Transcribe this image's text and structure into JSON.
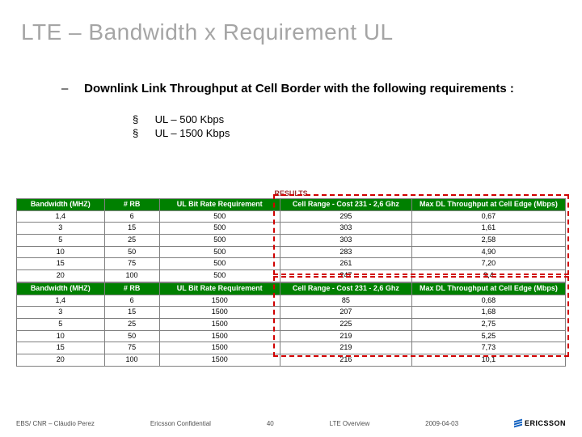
{
  "title": "LTE – Bandwidth x Requirement UL",
  "intro_prefix": "–",
  "intro": "Downlink Link Throughput at Cell Border with the following requirements :",
  "sublist": {
    "bullet": "§",
    "items": [
      "UL – 500 Kbps",
      "UL – 1500 Kbps"
    ]
  },
  "results_label": "RESULTS",
  "chart_data": [
    {
      "type": "table",
      "columns": [
        "Bandwidth (MHZ)",
        "# RB",
        "UL Bit Rate Requirement",
        "Cell Range - Cost 231 - 2,6 Ghz",
        "Max DL Throughput at Cell Edge (Mbps)"
      ],
      "rows": [
        [
          "1,4",
          "6",
          "500",
          "295",
          "0,67"
        ],
        [
          "3",
          "15",
          "500",
          "303",
          "1,61"
        ],
        [
          "5",
          "25",
          "500",
          "303",
          "2,58"
        ],
        [
          "10",
          "50",
          "500",
          "283",
          "4,90"
        ],
        [
          "15",
          "75",
          "500",
          "261",
          "7,20"
        ],
        [
          "20",
          "100",
          "500",
          "247",
          "9,4"
        ]
      ]
    },
    {
      "type": "table",
      "columns": [
        "Bandwidth (MHZ)",
        "# RB",
        "UL Bit Rate Requirement",
        "Cell Range - Cost 231 - 2,6 Ghz",
        "Max DL Throughput at Cell Edge (Mbps)"
      ],
      "rows": [
        [
          "1,4",
          "6",
          "1500",
          "85",
          "0,68"
        ],
        [
          "3",
          "15",
          "1500",
          "207",
          "1,68"
        ],
        [
          "5",
          "25",
          "1500",
          "225",
          "2,75"
        ],
        [
          "10",
          "50",
          "1500",
          "219",
          "5,25"
        ],
        [
          "15",
          "75",
          "1500",
          "219",
          "7,73"
        ],
        [
          "20",
          "100",
          "1500",
          "216",
          "10,1"
        ]
      ]
    }
  ],
  "footer": {
    "author": "EBS/ CNR – Cláudio Perez",
    "confidential": "Ericsson Confidential",
    "page": "40",
    "section": "LTE  Overview",
    "date": "2009-04-03",
    "logo": "ERICSSON"
  }
}
